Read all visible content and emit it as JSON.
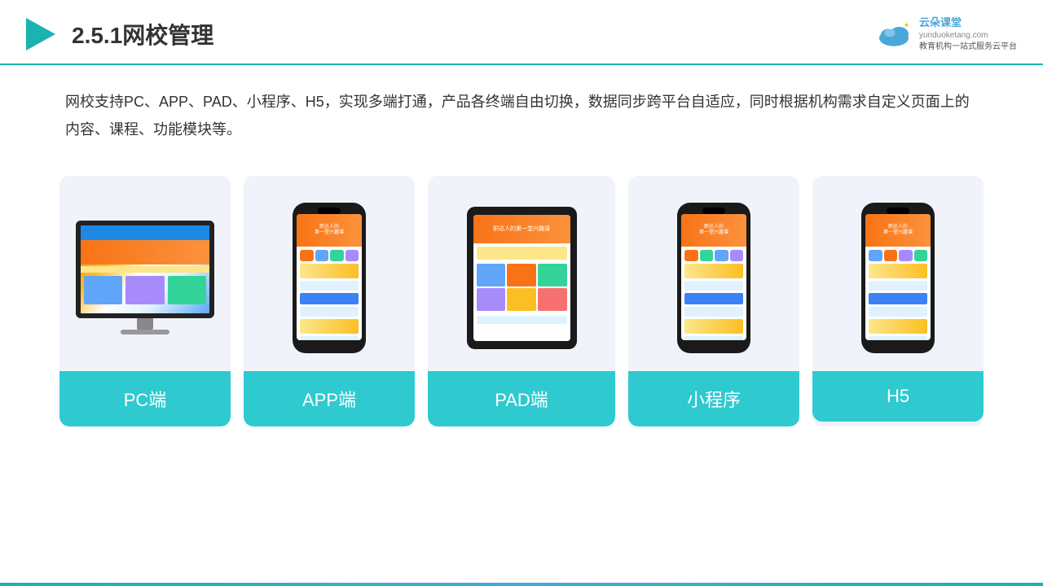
{
  "header": {
    "title": "2.5.1网校管理",
    "logo_name": "云朵课堂",
    "logo_url": "yunduoketang.com",
    "logo_sub": "教育机构一站式服务云平台"
  },
  "description": {
    "text": "网校支持PC、APP、PAD、小程序、H5，实现多端打通，产品各终端自由切换，数据同步跨平台自适应，同时根据机构需求自定义页面上的内容、课程、功能模块等。"
  },
  "cards": [
    {
      "id": "pc",
      "label": "PC端"
    },
    {
      "id": "app",
      "label": "APP端"
    },
    {
      "id": "pad",
      "label": "PAD端"
    },
    {
      "id": "miniprogram",
      "label": "小程序"
    },
    {
      "id": "h5",
      "label": "H5"
    }
  ],
  "colors": {
    "accent": "#2ecad0",
    "header_border": "#1ab3b0",
    "card_bg": "#f0f4fa",
    "text_dark": "#333333",
    "logo_blue": "#4aa8d8"
  }
}
